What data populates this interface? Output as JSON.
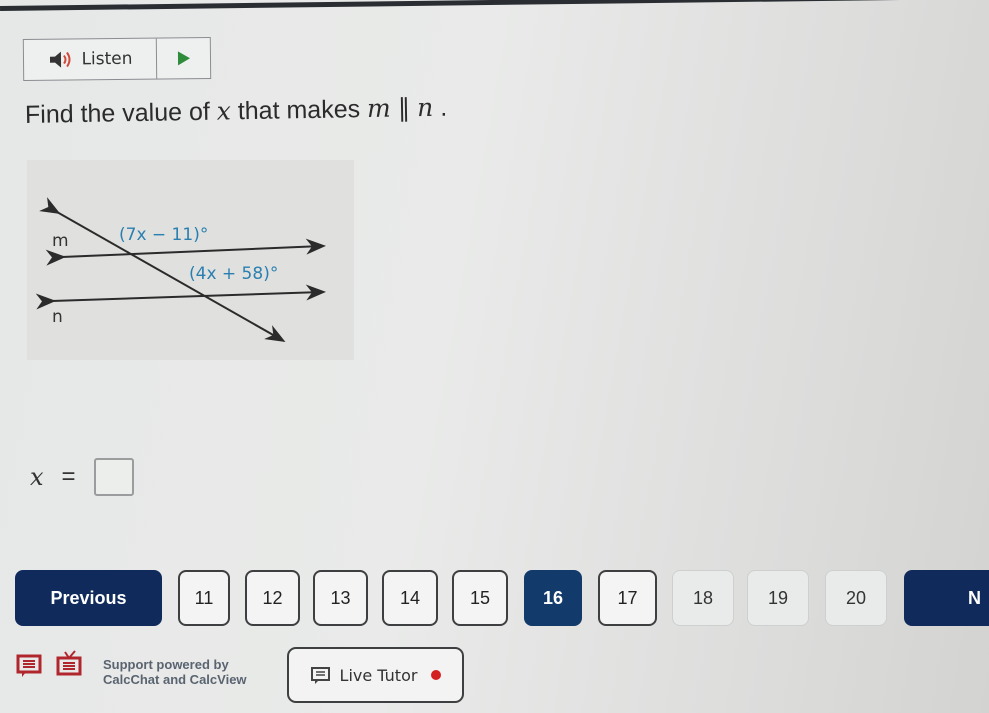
{
  "listen": {
    "label": "Listen",
    "icons": {
      "speaker": "speaker-icon",
      "play": "play-icon"
    }
  },
  "question": {
    "prefix": "Find the value of ",
    "variable": "x",
    "middle": " that makes ",
    "line1": "m",
    "parallel_symbol": "∥",
    "line2": "n",
    "suffix": " ."
  },
  "figure": {
    "line_m_label": "m",
    "line_n_label": "n",
    "angle_top": "(7x − 11)°",
    "angle_bottom": "(4x + 58)°",
    "label_color": "#2a7fb0"
  },
  "answer": {
    "variable": "x",
    "equals": "=",
    "value": ""
  },
  "nav": {
    "previous_label": "Previous",
    "next_label": "N",
    "pages": [
      "11",
      "12",
      "13",
      "14",
      "15",
      "16",
      "17",
      "18",
      "19",
      "20"
    ],
    "current_page": "16",
    "accent": "#102a5c"
  },
  "footer": {
    "support_line1": "Support powered by",
    "support_line2": "CalcChat and CalcView",
    "live_tutor_label": "Live Tutor",
    "status_color": "#d32020",
    "icon_color": "#b0262c"
  }
}
